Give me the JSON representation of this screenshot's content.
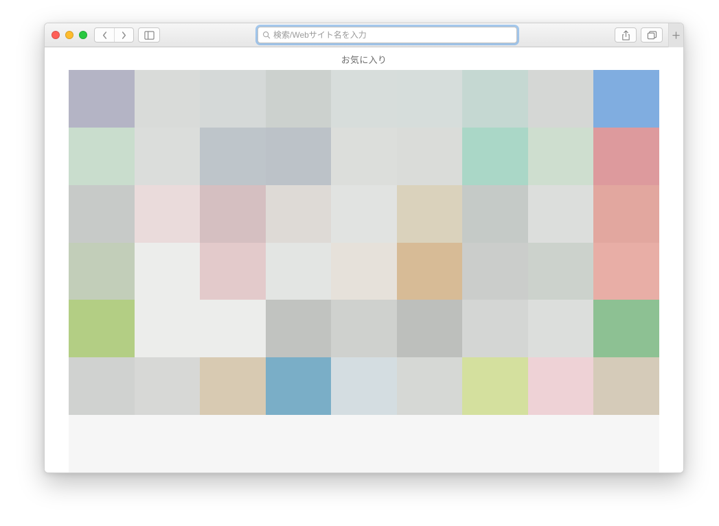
{
  "toolbar": {
    "address_placeholder": "検索/Webサイト名を入力",
    "address_value": ""
  },
  "content": {
    "favorites_title": "お気に入り"
  },
  "grid": {
    "columns": 9,
    "rows_visible": 7,
    "cells": [
      [
        "#b4b4c5",
        "#d9dbd9",
        "#d5d9d8",
        "#ccd1ce",
        "#d7dddb",
        "#d6dddb",
        "#c5d8d2",
        "#d5d7d5",
        "#80ade0"
      ],
      [
        "#c9ddcd",
        "#dbdddb",
        "#bec5ca",
        "#bcc2c8",
        "#dcdedb",
        "#dadcd9",
        "#aad7c7",
        "#cedecf",
        "#dd9a9d"
      ],
      [
        "#c7cac8",
        "#eadbdb",
        "#d5bfc1",
        "#dedad6",
        "#e1e3e1",
        "#dad2bc",
        "#c5cac7",
        "#dcdedc",
        "#e2a79f"
      ],
      [
        "#c2ceb9",
        "#ecedeb",
        "#e3cacb",
        "#e3e5e3",
        "#e6e1da",
        "#d7bb96",
        "#cbcdcb",
        "#ccd2cc",
        "#e8aea6"
      ],
      [
        "#b3ce84",
        "#ecedeb",
        "#ecedeb",
        "#c1c3c0",
        "#cfd1ce",
        "#bdbfbc",
        "#d4d6d4",
        "#dcdedc",
        "#8dc193"
      ],
      [
        "#d0d2d0",
        "#d7d8d6",
        "#d8cab2",
        "#7aaec7",
        "#d4dde1",
        "#d6d8d5",
        "#d4e09e",
        "#eed2d6",
        "#d5cbb9"
      ],
      [
        "#f6f6f6",
        "#f6f6f6",
        "#f6f6f6",
        "#f6f6f6",
        "#f6f6f6",
        "#f6f6f6",
        "#f6f6f6",
        "#f6f6f6",
        "#f6f6f6"
      ]
    ]
  }
}
